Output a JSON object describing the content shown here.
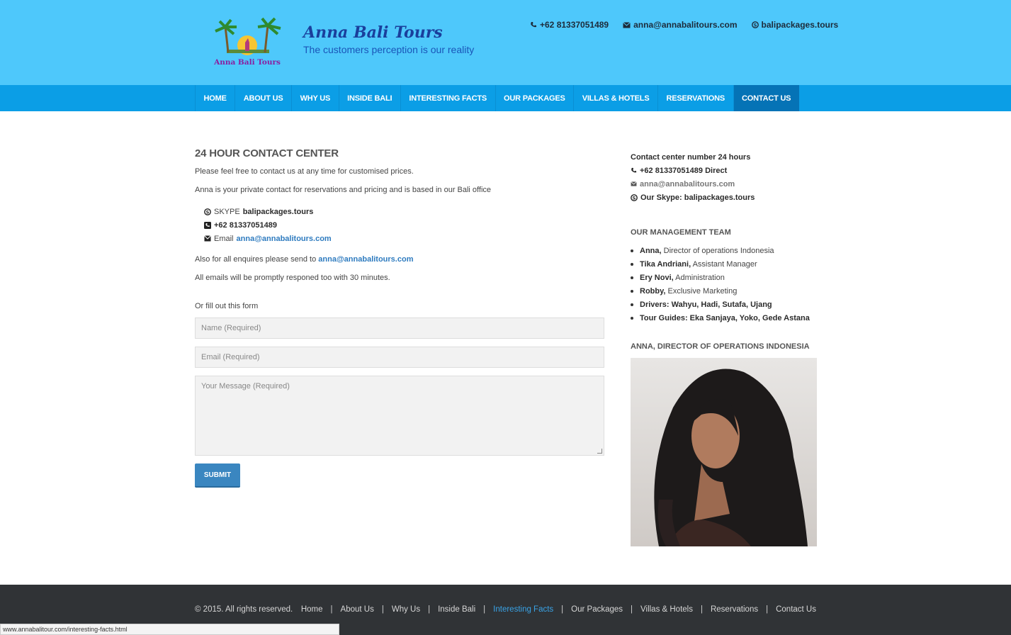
{
  "header": {
    "logo_text": "Anna Bali Tours",
    "brand_name": "Anna Bali Tours",
    "tagline": "The customers perception is our reality",
    "phone": "+62 81337051489",
    "email": "anna@annabalitours.com",
    "skype": "balipackages.tours"
  },
  "nav": {
    "items": [
      "HOME",
      "ABOUT US",
      "WHY US",
      "INSIDE BALI",
      "INTERESTING FACTS",
      "OUR PACKAGES",
      "VILLAS & HOTELS",
      "RESERVATIONS",
      "CONTACT US"
    ],
    "active": "CONTACT US"
  },
  "main": {
    "heading": "24 HOUR CONTACT CENTER",
    "intro1": "Please feel free to contact us at any time for customised prices.",
    "intro2": "Anna is your private contact for reservations and pricing and is based in our Bali office",
    "skype_label": "SKYPE",
    "skype_value": "balipackages.tours",
    "phone_value": "+62 81337051489",
    "email_label": "Email",
    "email_value": "anna@annabalitours.com",
    "enquiries_text": "Also for all enquires please send to",
    "enquiries_email": "anna@annabalitours.com",
    "response_text": "All emails will be promptly responed too with 30 minutes.",
    "form_intro": "Or fill out this form",
    "name_placeholder": "Name (Required)",
    "email_placeholder": "Email (Required)",
    "message_placeholder": "Your Message (Required)",
    "submit_label": "SUBMIT"
  },
  "sidebar": {
    "contact_heading": "Contact center number 24 hours",
    "phone_line": "+62 81337051489 Direct",
    "email_line": "anna@annabalitours.com",
    "skype_line": "Our Skype: balipackages.tours",
    "team_heading": "OUR MANAGEMENT TEAM",
    "team": [
      {
        "name": "Anna,",
        "role": " Director of operations Indonesia"
      },
      {
        "name": "Tika Andriani,",
        "role": " Assistant Manager"
      },
      {
        "name": "Ery Novi,",
        "role": " Administration"
      },
      {
        "name": "Robby,",
        "role": " Exclusive Marketing"
      },
      {
        "name": "Drivers: Wahyu, Hadi, Sutafa, Ujang",
        "role": ""
      },
      {
        "name": "Tour Guides: Eka Sanjaya, Yoko, Gede Astana",
        "role": ""
      }
    ],
    "photo_heading": "ANNA, DIRECTOR OF OPERATIONS INDONESIA"
  },
  "footer": {
    "copyright": "© 2015. All rights reserved.",
    "links": [
      "Home",
      "About Us",
      "Why Us",
      "Inside Bali",
      "Interesting Facts",
      "Our Packages",
      "Villas & Hotels",
      "Reservations",
      "Contact Us"
    ],
    "highlighted": "Interesting Facts"
  },
  "status_bar": {
    "url": "www.annabalitour.com/interesting-facts.html"
  },
  "colors": {
    "header_bg": "#4ec8fb",
    "nav_bg": "#0b9ee6",
    "nav_active": "#0573b6",
    "link": "#2e7bbf",
    "footer_bg": "#303336"
  }
}
